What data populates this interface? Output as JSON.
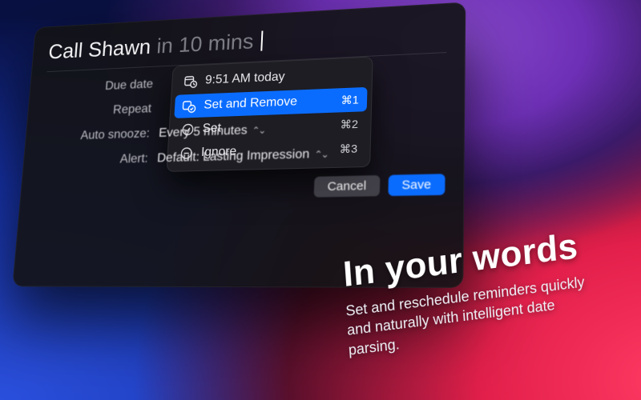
{
  "title": {
    "task_text": "Call Shawn",
    "parsed_suffix": "in 10 mins"
  },
  "popover": {
    "header_time": "9:51 AM today",
    "items": [
      {
        "label": "Set and Remove",
        "shortcut": "⌘1",
        "icon": "set-remove",
        "selected": true
      },
      {
        "label": "Set",
        "shortcut": "⌘2",
        "icon": "set",
        "selected": false
      },
      {
        "label": "Ignore",
        "shortcut": "⌘3",
        "icon": "ignore",
        "selected": false
      }
    ]
  },
  "form": {
    "due_date_label": "Due date",
    "repeat_label": "Repeat",
    "auto_snooze_label": "Auto snooze:",
    "auto_snooze_value": "Every 5 minutes",
    "alert_label": "Alert:",
    "alert_value": "Default: Lasting Impression"
  },
  "buttons": {
    "cancel": "Cancel",
    "save": "Save"
  },
  "marketing": {
    "headline": "In your words",
    "body": "Set and reschedule reminders quickly and naturally with intelligent date parsing."
  },
  "colors": {
    "accent": "#0a6cff"
  }
}
